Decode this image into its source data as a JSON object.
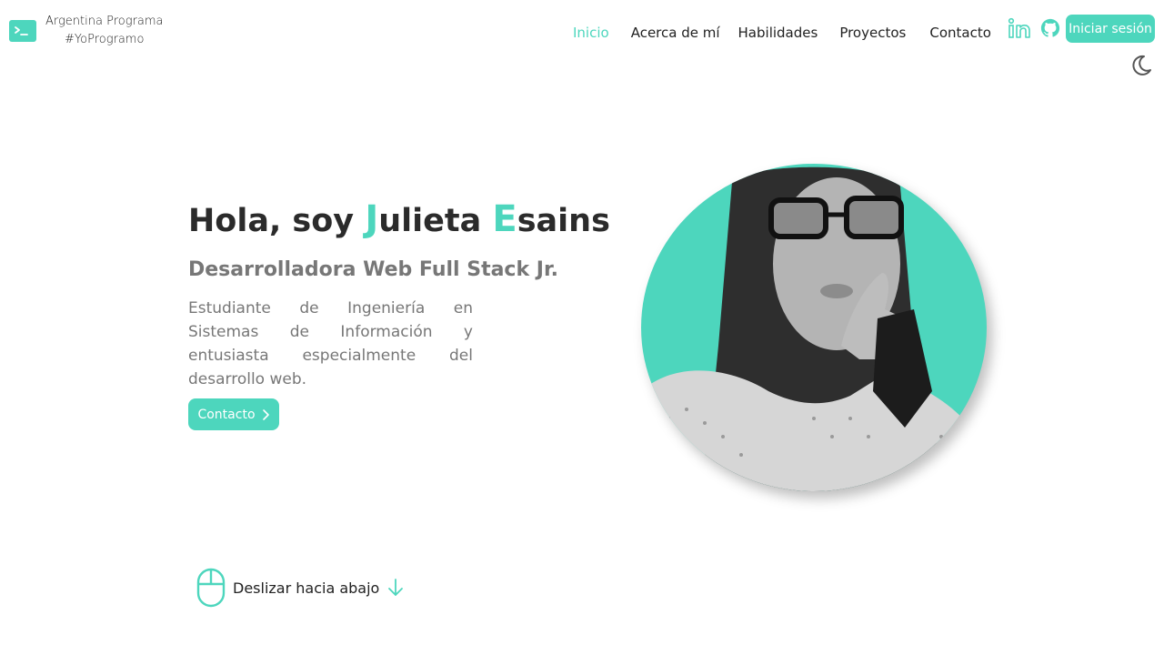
{
  "brand": {
    "line1": "Argentina Programa",
    "line2": "#YoProgramo",
    "icon": "terminal-icon"
  },
  "nav": {
    "items": [
      {
        "label": "Inicio",
        "active": true
      },
      {
        "label": "Acerca de mí",
        "active": false
      },
      {
        "label": "Habilidades",
        "active": false
      },
      {
        "label": "Proyectos",
        "active": false
      },
      {
        "label": "Contacto",
        "active": false
      }
    ]
  },
  "header": {
    "social_icons": [
      "linkedin-icon",
      "github-icon"
    ],
    "login_label": "Iniciar sesión",
    "theme_icon": "moon-icon"
  },
  "hero": {
    "title_prefix": "Hola, soy ",
    "first_initial": "J",
    "first_rest": "ulieta ",
    "last_initial": "E",
    "last_rest": "sains",
    "subtitle": "Desarrolladora Web Full Stack Jr.",
    "description": "Estudiante de Ingeniería en Sistemas de Información y entusiasta especialmente del desarrollo web.",
    "cta_label": "Contacto",
    "cta_icon": "chevron-right-icon"
  },
  "scroll": {
    "label": "Deslizar hacia abajo",
    "icons": [
      "mouse-icon",
      "arrow-down-icon"
    ]
  },
  "colors": {
    "accent": "#4dd6bd",
    "text": "#222222",
    "muted": "#777777"
  }
}
